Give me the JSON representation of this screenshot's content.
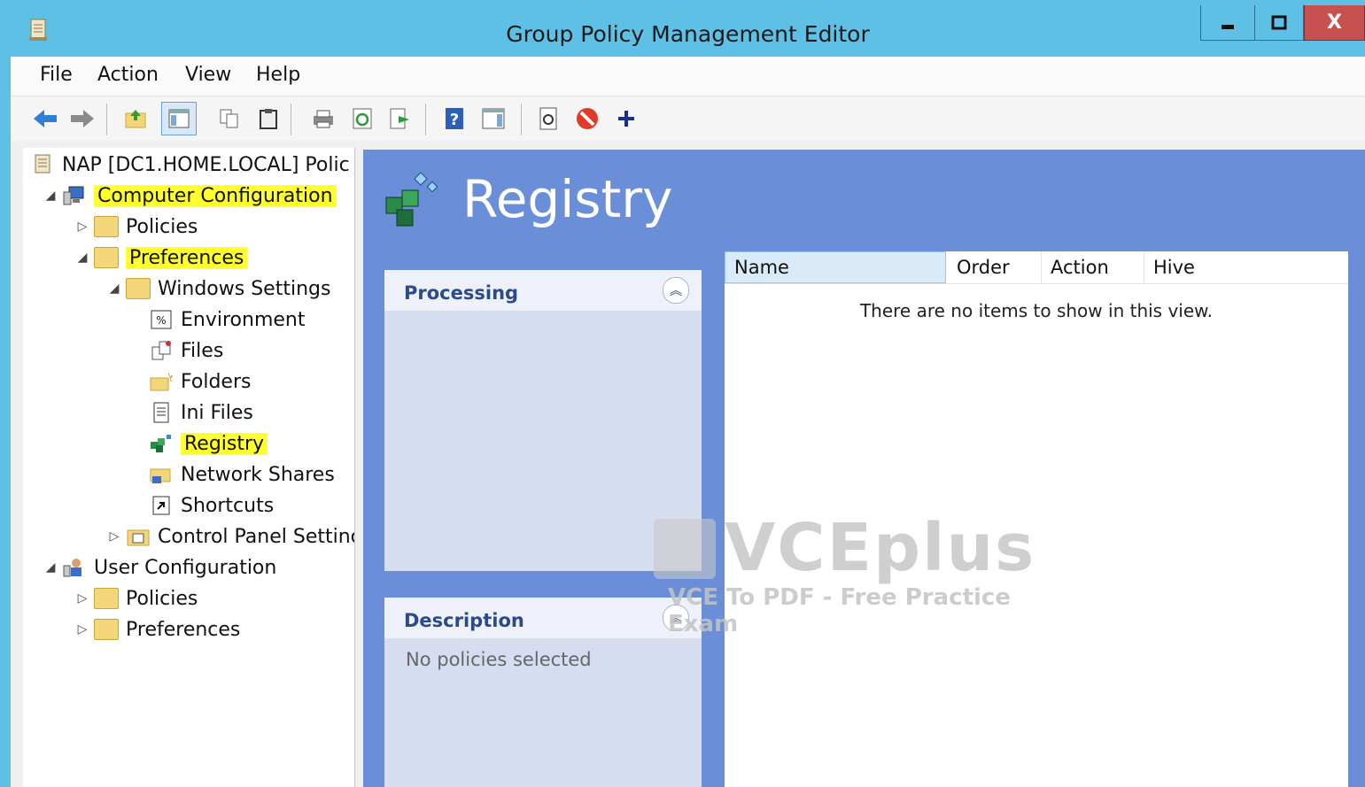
{
  "window": {
    "title": "Group Policy Management Editor",
    "controls": {
      "minimize": "–",
      "maximize": "□",
      "close": "X"
    },
    "accent": "#5fc0e6"
  },
  "menu": [
    "File",
    "Action",
    "View",
    "Help"
  ],
  "toolbar": [
    "back-icon",
    "forward-icon",
    "up-folder-icon",
    "show-hide-tree-icon",
    "copy-icon",
    "paste-icon",
    "print-icon",
    "refresh-icon",
    "export-list-icon",
    "help-icon",
    "show-hide-action-pane-icon",
    "properties-icon",
    "stop-icon",
    "add-icon"
  ],
  "tree": {
    "root": "NAP [DC1.HOME.LOCAL] Polic",
    "computer_configuration": "Computer Configuration",
    "cc_policies": "Policies",
    "cc_preferences": "Preferences",
    "windows_settings": "Windows Settings",
    "environment": "Environment",
    "files": "Files",
    "folders": "Folders",
    "ini_files": "Ini Files",
    "registry": "Registry",
    "network_shares": "Network Shares",
    "shortcuts": "Shortcuts",
    "control_panel_settings": "Control Panel Settinc",
    "user_configuration": "User Configuration",
    "uc_policies": "Policies",
    "uc_preferences": "Preferences",
    "highlight_color": "#ffff2e"
  },
  "details": {
    "heading": "Registry",
    "processing_title": "Processing",
    "description_title": "Description",
    "description_text": "No policies selected",
    "columns": [
      "Name",
      "Order",
      "Action",
      "Hive"
    ],
    "empty_message": "There are no items to show in this view.",
    "background": "#6a8fd8"
  },
  "watermark": {
    "brand": "VCEplus",
    "tagline": "VCE To PDF - Free Practice Exam"
  }
}
